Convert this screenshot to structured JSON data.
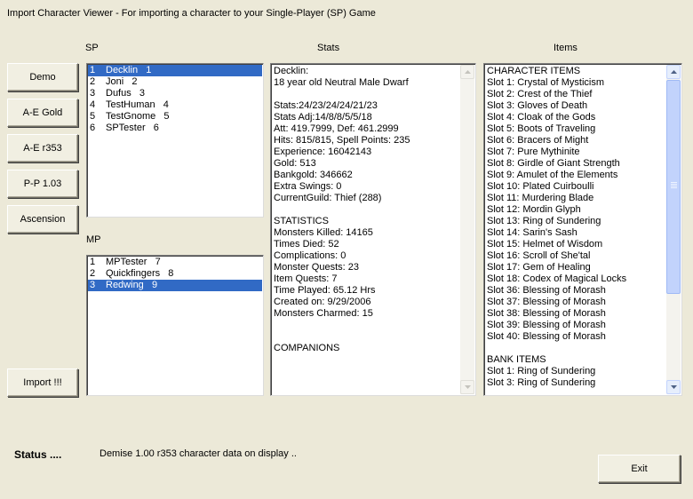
{
  "window": {
    "title": "Import Character Viewer - For importing a character to your Single-Player (SP) Game"
  },
  "labels": {
    "sp": "SP",
    "mp": "MP",
    "stats": "Stats",
    "items": "Items"
  },
  "buttons": {
    "demo": "Demo",
    "ae_gold": "A-E Gold",
    "ae_r353": "A-E r353",
    "pp_103": "P-P 1.03",
    "ascension": "Ascension",
    "import": "Import !!!",
    "exit": "Exit"
  },
  "sp_list": [
    {
      "num": "1",
      "name": "Decklin   1",
      "selected": true
    },
    {
      "num": "2",
      "name": "Joni   2",
      "selected": false
    },
    {
      "num": "3",
      "name": "Dufus   3",
      "selected": false
    },
    {
      "num": "4",
      "name": "TestHuman   4",
      "selected": false
    },
    {
      "num": "5",
      "name": "TestGnome   5",
      "selected": false
    },
    {
      "num": "6",
      "name": "SPTester   6",
      "selected": false
    }
  ],
  "mp_list": [
    {
      "num": "1",
      "name": "MPTester   7",
      "selected": false
    },
    {
      "num": "2",
      "name": "Quickfingers   8",
      "selected": false
    },
    {
      "num": "3",
      "name": "Redwing   9",
      "selected": true
    }
  ],
  "stats_lines": [
    "Decklin:",
    "18 year old Neutral Male Dwarf",
    "",
    "Stats:24/23/24/24/21/23",
    "Stats Adj:14/8/8/5/5/18",
    "Att: 419.7999, Def: 461.2999",
    "Hits: 815/815, Spell Points: 235",
    "Experience: 16042143",
    "Gold: 513",
    "Bankgold: 346662",
    "Extra Swings: 0",
    "CurrentGuild: Thief (288)",
    "",
    "STATISTICS",
    "Monsters Killed: 14165",
    "Times Died: 52",
    "Complications: 0",
    "Monster Quests: 23",
    "Item Quests: 7",
    "Time Played: 65.12 Hrs",
    "Created on: 9/29/2006",
    "Monsters Charmed: 15",
    "",
    "",
    "COMPANIONS"
  ],
  "items_lines": [
    "CHARACTER ITEMS",
    "Slot 1: Crystal of Mysticism",
    "Slot 2: Crest of the Thief",
    "Slot 3: Gloves of Death",
    "Slot 4: Cloak of the Gods",
    "Slot 5: Boots of Traveling",
    "Slot 6: Bracers of Might",
    "Slot 7: Pure Mythinite",
    "Slot 8: Girdle of Giant Strength",
    "Slot 9: Amulet of the Elements",
    "Slot 10: Plated Cuirboulli",
    "Slot 11: Murdering Blade",
    "Slot 12: Mordin Glyph",
    "Slot 13: Ring of Sundering",
    "Slot 14: Sarin's Sash",
    "Slot 15: Helmet of Wisdom",
    "Slot 16: Scroll of She'tal",
    "Slot 17: Gem of Healing",
    "Slot 18: Codex of Magical Locks",
    "Slot 36: Blessing of Morash",
    "Slot 37: Blessing of Morash",
    "Slot 38: Blessing of Morash",
    "Slot 39: Blessing of Morash",
    "Slot 40: Blessing of Morash",
    "",
    "BANK ITEMS",
    "Slot 1: Ring of Sundering",
    "Slot 3: Ring of Sundering"
  ],
  "status": {
    "label": "Status ....",
    "text": "Demise 1.00 r353 character data on display .."
  },
  "icons": {
    "scroll_up": "scroll-up-arrow-icon",
    "scroll_down": "scroll-down-arrow-icon"
  },
  "colors": {
    "selection": "#316ac5",
    "window_bg": "#ece9d8"
  }
}
